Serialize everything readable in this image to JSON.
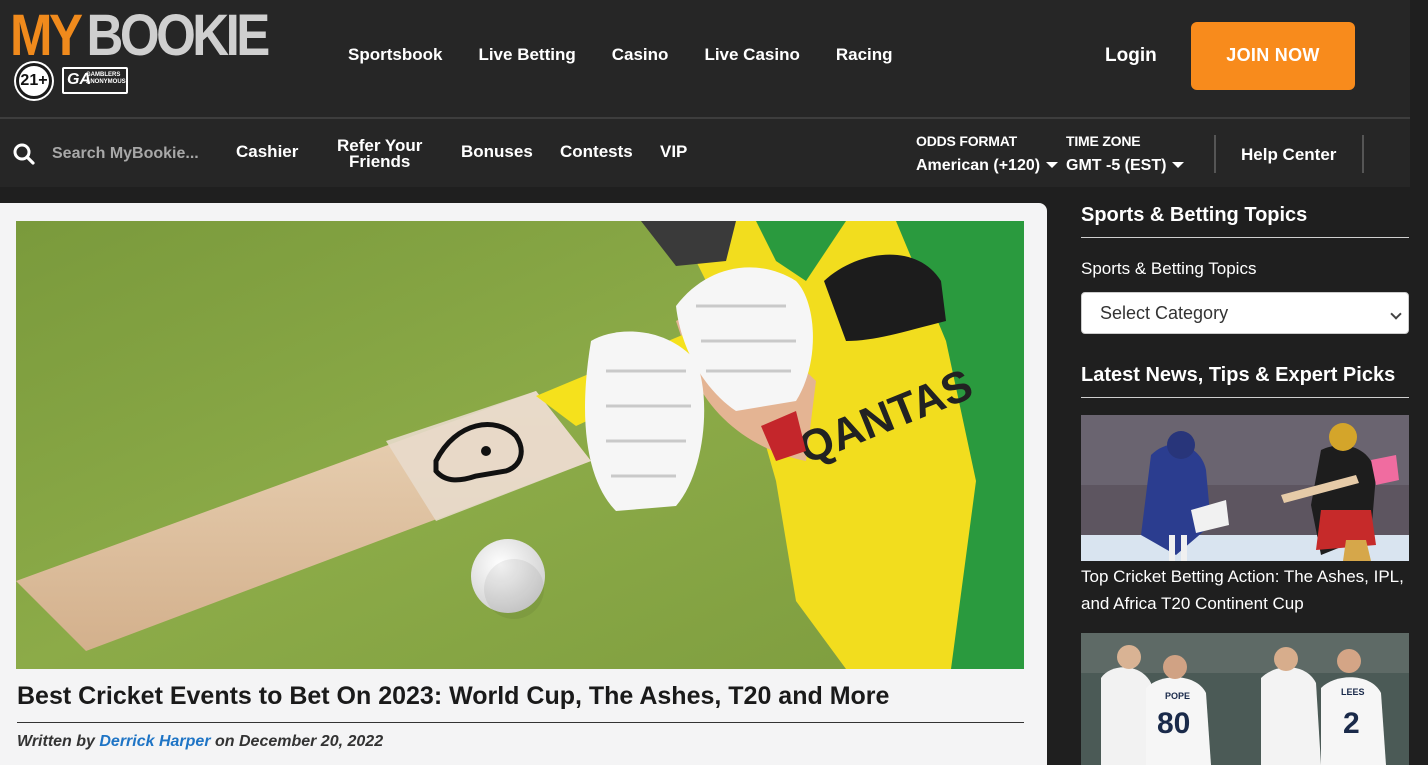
{
  "brand": {
    "logo_my": "MY",
    "logo_bookie": "BOOKIE",
    "age_badge": "21+",
    "ga_badge": "GA",
    "ga_small": "GAMBLERS ANONYMOUS"
  },
  "main_nav": [
    "Sportsbook",
    "Live Betting",
    "Casino",
    "Live Casino",
    "Racing"
  ],
  "login_label": "Login",
  "join_label": "JOIN NOW",
  "search": {
    "placeholder": "Search MyBookie..."
  },
  "sub_nav": {
    "cashier": "Cashier",
    "refer_line1": "Refer Your",
    "refer_line2": "Friends",
    "bonuses": "Bonuses",
    "contests": "Contests",
    "vip": "VIP"
  },
  "odds_format": {
    "label": "ODDS FORMAT",
    "value": "American (+120)"
  },
  "time_zone": {
    "label": "TIME ZONE",
    "value": "GMT -5 (EST)"
  },
  "help_center": "Help Center",
  "article": {
    "title": "Best Cricket Events to Bet On 2023: World Cup, The Ashes, T20 and More",
    "byline_prefix": "Written by ",
    "author": "Derrick Harper",
    "byline_suffix": " on December 20, 2022",
    "sponsor_text": "QANTAS"
  },
  "sidebar": {
    "topics_heading": "Sports & Betting Topics",
    "topics_label": "Sports & Betting Topics",
    "select_value": "Select Category",
    "news_heading": "Latest News, Tips & Expert Picks",
    "news_items": [
      {
        "title": "Top Cricket Betting Action: The Ashes, IPL, and Africa T20 Continent Cup"
      },
      {
        "title": ""
      }
    ],
    "jersey_numbers": [
      "80",
      "2"
    ],
    "jersey_names": [
      "POPE",
      "LEES"
    ]
  },
  "colors": {
    "accent": "#f88b1c",
    "link": "#1e74c5",
    "header_bg": "#262626"
  }
}
